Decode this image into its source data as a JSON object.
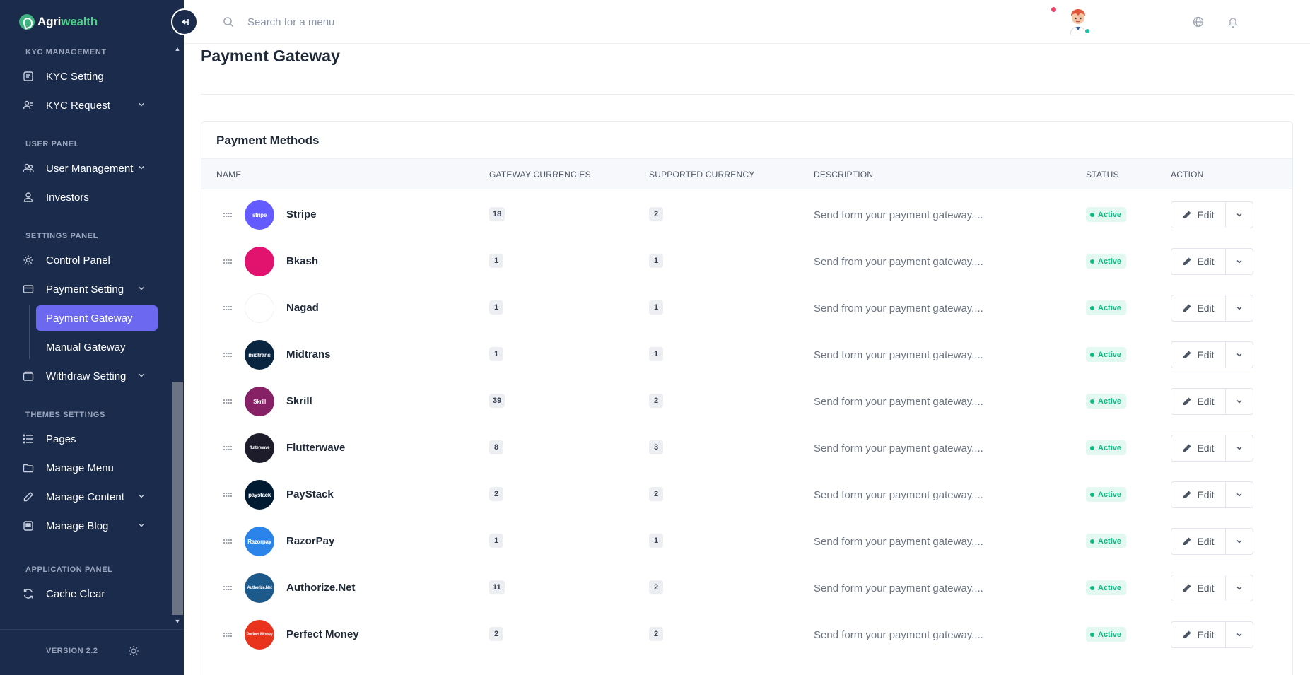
{
  "brand": {
    "name_part1": "Agri",
    "name_part2": "wealth"
  },
  "sidebar": {
    "sections": [
      {
        "label": "KYC MANAGEMENT"
      },
      {
        "label": "USER PANEL"
      },
      {
        "label": "SETTINGS PANEL"
      },
      {
        "label": "THEMES SETTINGS"
      },
      {
        "label": "APPLICATION PANEL"
      }
    ],
    "items": [
      {
        "label": "KYC Setting",
        "icon": "kyc-setting-icon"
      },
      {
        "label": "KYC Request",
        "icon": "kyc-request-icon",
        "has_children": true
      },
      {
        "label": "User Management",
        "icon": "users-icon",
        "has_children": true
      },
      {
        "label": "Investors",
        "icon": "user-icon"
      },
      {
        "label": "Control Panel",
        "icon": "gear-icon"
      },
      {
        "label": "Payment Setting",
        "icon": "wallet-icon",
        "has_children": true,
        "expanded": true
      },
      {
        "label": "Withdraw Setting",
        "icon": "withdraw-icon",
        "has_children": true
      },
      {
        "label": "Pages",
        "icon": "list-icon"
      },
      {
        "label": "Manage Menu",
        "icon": "folder-icon"
      },
      {
        "label": "Manage Content",
        "icon": "pencil-icon",
        "has_children": true
      },
      {
        "label": "Manage Blog",
        "icon": "blog-icon",
        "has_children": true
      },
      {
        "label": "Cache Clear",
        "icon": "refresh-icon"
      }
    ],
    "payment_sub": [
      {
        "label": "Payment Gateway",
        "active": true
      },
      {
        "label": "Manual Gateway",
        "active": false
      }
    ],
    "version": "VERSION 2.2"
  },
  "header": {
    "search_placeholder": "Search for a menu"
  },
  "page": {
    "title": "Payment Gateway",
    "card_title": "Payment Methods",
    "columns": [
      "NAME",
      "GATEWAY CURRENCIES",
      "SUPPORTED CURRENCY",
      "DESCRIPTION",
      "STATUS",
      "ACTION"
    ],
    "edit_label": "Edit",
    "rows": [
      {
        "name": "Stripe",
        "logo_text": "stripe",
        "logo_color": "#635bff",
        "gateway_currencies": "18",
        "supported_currency": "2",
        "description": "Send form your payment gateway....",
        "status": "Active"
      },
      {
        "name": "Bkash",
        "logo_text": "",
        "logo_color": "#e2136e",
        "gateway_currencies": "1",
        "supported_currency": "1",
        "description": "Send from your payment gateway....",
        "status": "Active"
      },
      {
        "name": "Nagad",
        "logo_text": "",
        "logo_color": "#ffffff",
        "gateway_currencies": "1",
        "supported_currency": "1",
        "description": "Send from your payment gateway....",
        "status": "Active"
      },
      {
        "name": "Midtrans",
        "logo_text": "midtrans",
        "logo_color": "#0a2540",
        "gateway_currencies": "1",
        "supported_currency": "1",
        "description": "Send form your payment gateway....",
        "status": "Active"
      },
      {
        "name": "Skrill",
        "logo_text": "Skrill",
        "logo_color": "#862165",
        "gateway_currencies": "39",
        "supported_currency": "2",
        "description": "Send form your payment gateway....",
        "status": "Active"
      },
      {
        "name": "Flutterwave",
        "logo_text": "flutterwave",
        "logo_color": "#1c1c2b",
        "gateway_currencies": "8",
        "supported_currency": "3",
        "description": "Send form your payment gateway....",
        "status": "Active"
      },
      {
        "name": "PayStack",
        "logo_text": "paystack",
        "logo_color": "#011b33",
        "gateway_currencies": "2",
        "supported_currency": "2",
        "description": "Send form your payment gateway....",
        "status": "Active"
      },
      {
        "name": "RazorPay",
        "logo_text": "Razorpay",
        "logo_color": "#2b84ea",
        "gateway_currencies": "1",
        "supported_currency": "1",
        "description": "Send form your payment gateway....",
        "status": "Active"
      },
      {
        "name": "Authorize.Net",
        "logo_text": "Authorize.Net",
        "logo_color": "#1d5a8c",
        "gateway_currencies": "11",
        "supported_currency": "2",
        "description": "Send form your payment gateway....",
        "status": "Active"
      },
      {
        "name": "Perfect Money",
        "logo_text": "Perfect Money",
        "logo_color": "#e8341c",
        "gateway_currencies": "2",
        "supported_currency": "2",
        "description": "Send form your payment gateway....",
        "status": "Active"
      }
    ]
  },
  "colors": {
    "sidebar_bg": "#1a2b4c",
    "accent": "#6c68f0",
    "status_active": "#10b981",
    "notification": "#f0446a"
  }
}
